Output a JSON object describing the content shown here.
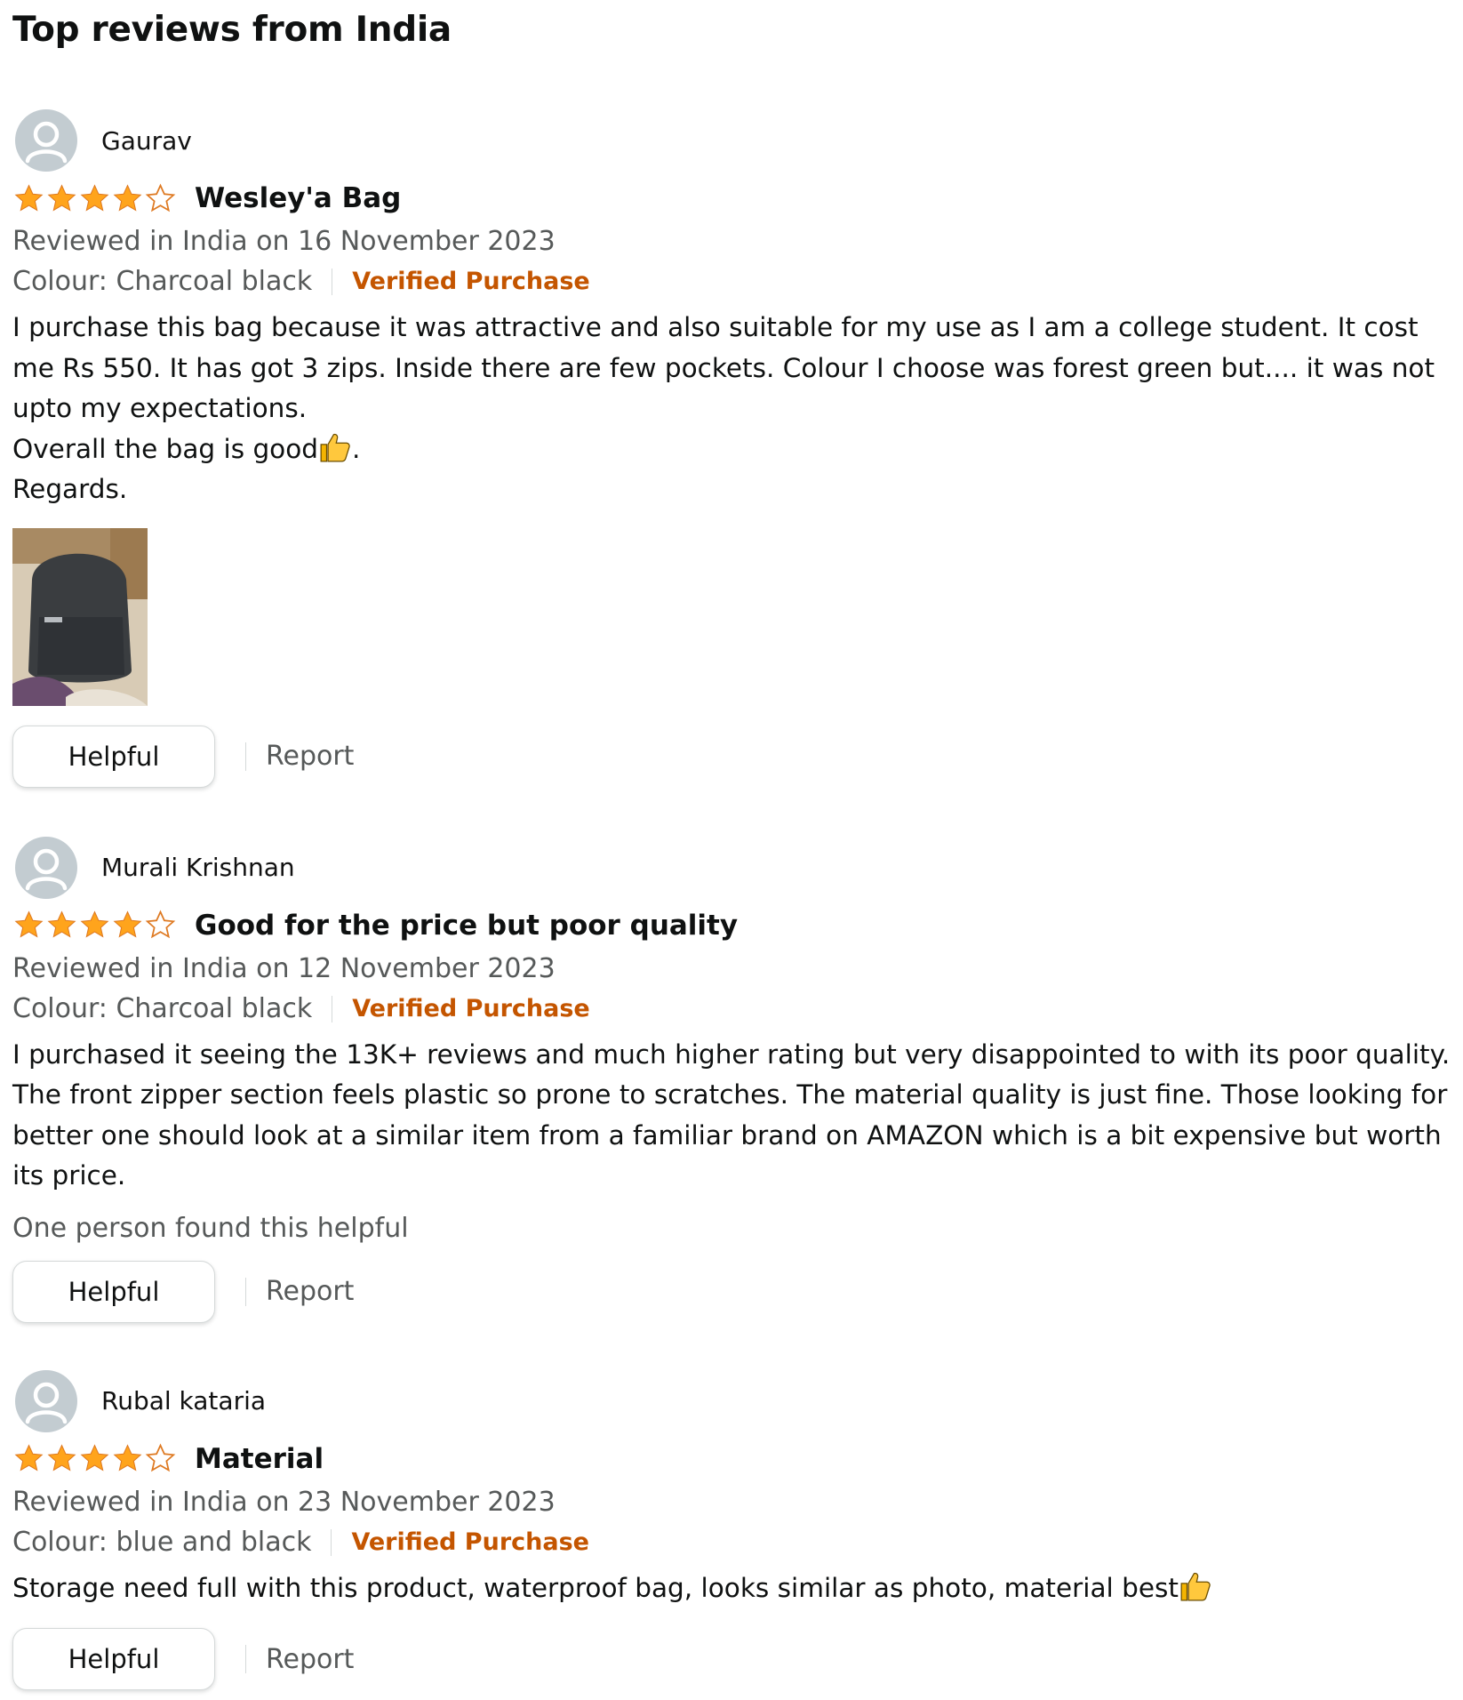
{
  "section_title": "Top reviews from India",
  "colors": {
    "verified": "#c45500",
    "star": "#ffa41c",
    "muted": "#565959",
    "avatar": "#c3ccd1"
  },
  "reviews": [
    {
      "profile_name": "Gaurav",
      "rating": 4,
      "rating_max": 5,
      "title": "Wesley'a Bag",
      "date": "Reviewed in India on 16 November 2023",
      "colour": "Colour: Charcoal black",
      "verified": "Verified Purchase",
      "body": [
        "I purchase this bag because it was attractive and also suitable for my use as I am a college student. It cost me Rs 550. It has got 3 zips. Inside there are few pockets. Colour I choose was forest green but.... it was not upto my expectations.",
        "Overall the bag is good",
        ".",
        "Regards."
      ],
      "image": "backpack-photo",
      "helpful_label": "Helpful",
      "report_label": "Report"
    },
    {
      "profile_name": "Murali Krishnan",
      "rating": 4,
      "rating_max": 5,
      "title": "Good for the price but poor quality",
      "date": "Reviewed in India on 12 November 2023",
      "colour": "Colour: Charcoal black",
      "verified": "Verified Purchase",
      "body": [
        "I purchased it seeing the 13K+ reviews and much higher rating but very disappointed to with its poor quality. The front zipper section feels plastic so prone to scratches. The material quality is just fine. Those looking for better one should look at a similar item from a familiar brand on AMAZON which is a bit expensive but worth its price."
      ],
      "helpful_count": "One person found this helpful",
      "helpful_label": "Helpful",
      "report_label": "Report"
    },
    {
      "profile_name": "Rubal kataria",
      "rating": 4,
      "rating_max": 5,
      "title": "Material",
      "date": "Reviewed in India on 23 November 2023",
      "colour": "Colour: blue and black",
      "verified": "Verified Purchase",
      "body": [
        "Storage need full with this product, waterproof bag, looks similar as photo, material best"
      ],
      "helpful_label": "Helpful",
      "report_label": "Report"
    }
  ]
}
